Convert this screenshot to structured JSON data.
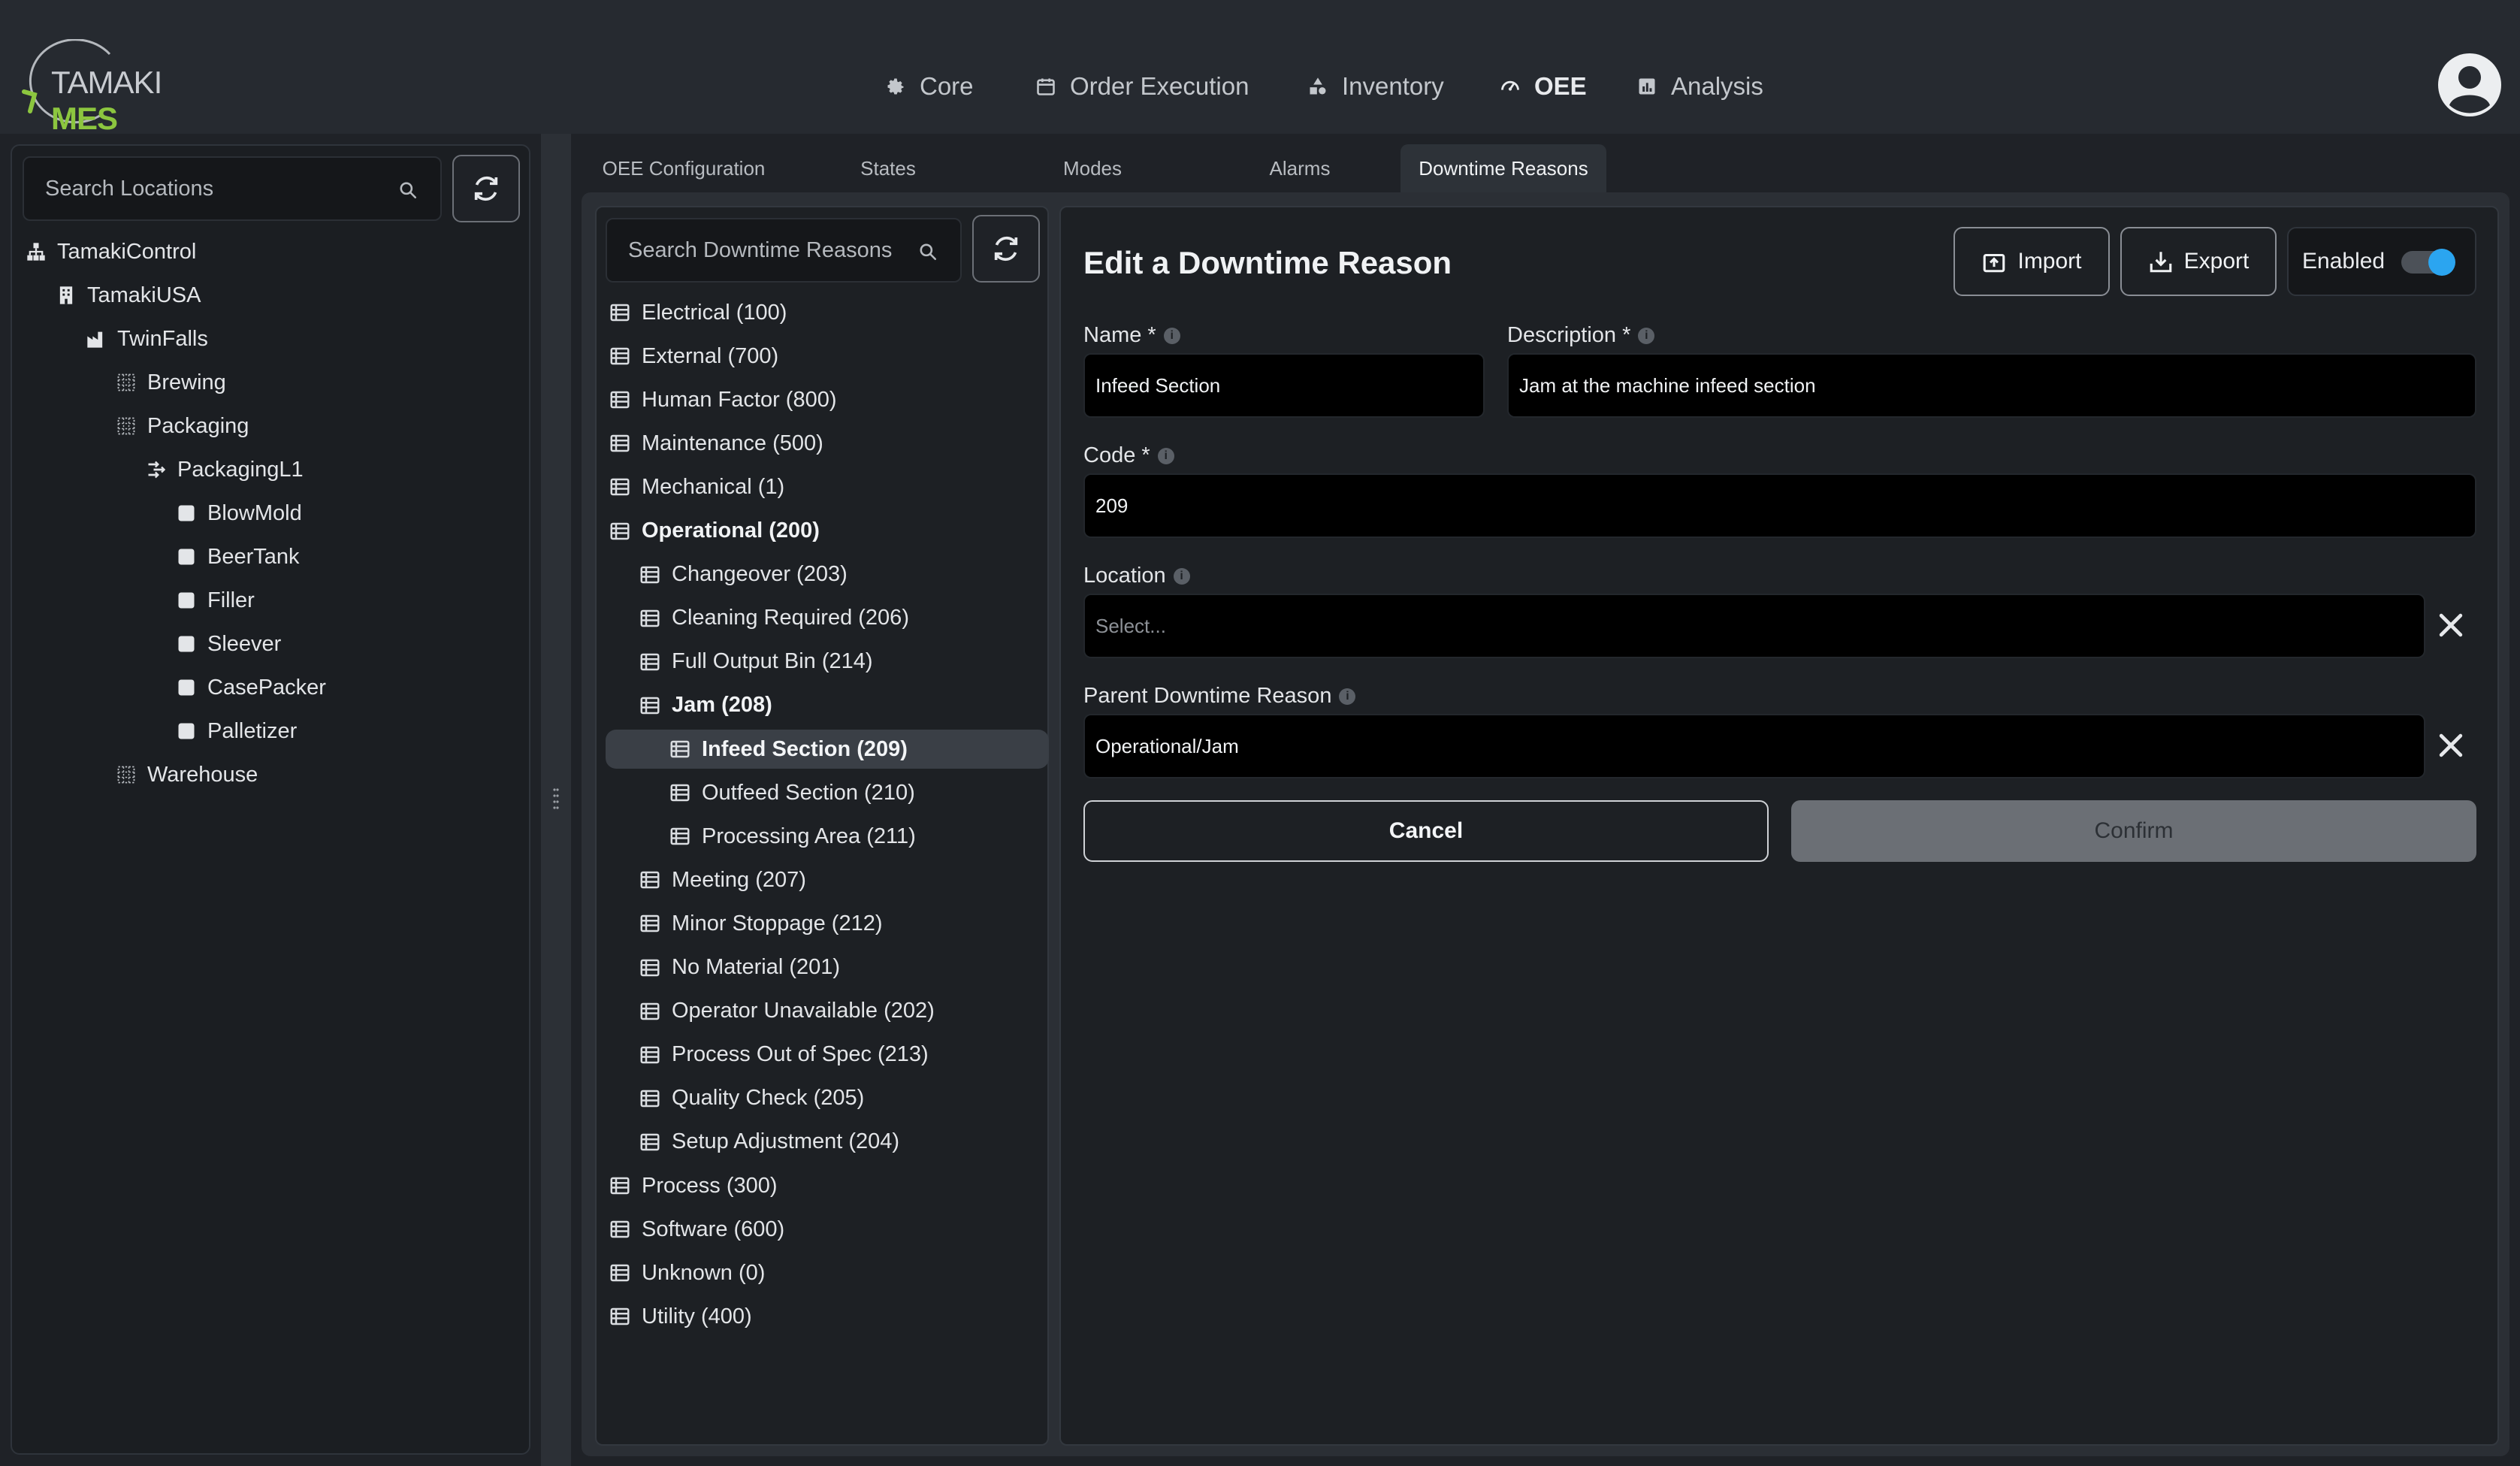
{
  "brand": {
    "part1": "TAMAKI",
    "part2": "MES"
  },
  "nav": [
    {
      "label": "Core",
      "icon": "gear-icon"
    },
    {
      "label": "Order Execution",
      "icon": "calendar-icon"
    },
    {
      "label": "Inventory",
      "icon": "shapes-icon"
    },
    {
      "label": "OEE",
      "icon": "gauge-icon",
      "active": true
    },
    {
      "label": "Analysis",
      "icon": "chart-icon"
    }
  ],
  "locations": {
    "search_placeholder": "Search Locations",
    "tree": [
      {
        "label": "TamakiControl",
        "icon": "org-icon"
      },
      {
        "label": "TamakiUSA",
        "icon": "building-icon"
      },
      {
        "label": "TwinFalls",
        "icon": "factory-icon"
      },
      {
        "label": "Brewing",
        "icon": "area-icon"
      },
      {
        "label": "Packaging",
        "icon": "area-icon"
      },
      {
        "label": "PackagingL1",
        "icon": "line-icon"
      },
      {
        "label": "BlowMold",
        "icon": "cell-icon"
      },
      {
        "label": "BeerTank",
        "icon": "cell-icon"
      },
      {
        "label": "Filler",
        "icon": "cell-icon"
      },
      {
        "label": "Sleever",
        "icon": "cell-icon"
      },
      {
        "label": "CasePacker",
        "icon": "cell-icon"
      },
      {
        "label": "Palletizer",
        "icon": "cell-icon"
      },
      {
        "label": "Warehouse",
        "icon": "area-icon"
      }
    ]
  },
  "tabs": [
    {
      "label": "OEE Configuration"
    },
    {
      "label": "States"
    },
    {
      "label": "Modes"
    },
    {
      "label": "Alarms"
    },
    {
      "label": "Downtime Reasons",
      "active": true
    }
  ],
  "reasons": {
    "search_placeholder": "Search Downtime Reasons",
    "items": [
      {
        "label": "Electrical (100)"
      },
      {
        "label": "External (700)"
      },
      {
        "label": "Human Factor (800)"
      },
      {
        "label": "Maintenance (500)"
      },
      {
        "label": "Mechanical (1)"
      },
      {
        "label": "Operational (200)"
      },
      {
        "label": "Changeover (203)"
      },
      {
        "label": "Cleaning Required (206)"
      },
      {
        "label": "Full Output Bin (214)"
      },
      {
        "label": "Jam (208)"
      },
      {
        "label": "Infeed Section (209)"
      },
      {
        "label": "Outfeed Section (210)"
      },
      {
        "label": "Processing Area (211)"
      },
      {
        "label": "Meeting (207)"
      },
      {
        "label": "Minor Stoppage (212)"
      },
      {
        "label": "No Material (201)"
      },
      {
        "label": "Operator Unavailable (202)"
      },
      {
        "label": "Process Out of Spec (213)"
      },
      {
        "label": "Quality Check (205)"
      },
      {
        "label": "Setup Adjustment (204)"
      },
      {
        "label": "Process (300)"
      },
      {
        "label": "Software (600)"
      },
      {
        "label": "Unknown (0)"
      },
      {
        "label": "Utility (400)"
      }
    ]
  },
  "form": {
    "title": "Edit a Downtime Reason",
    "import_label": "Import",
    "export_label": "Export",
    "enabled_label": "Enabled",
    "enabled": true,
    "name_label": "Name *",
    "name_value": "Infeed Section",
    "description_label": "Description *",
    "description_value": "Jam at the machine infeed section",
    "code_label": "Code *",
    "code_value": "209",
    "location_label": "Location",
    "location_placeholder": "Select...",
    "parent_label": "Parent Downtime Reason",
    "parent_value": "Operational/Jam",
    "cancel_label": "Cancel",
    "confirm_label": "Confirm",
    "info_glyph": "i"
  },
  "colors": {
    "accent": "#2ba5f0",
    "brand_green": "#8cc63f",
    "background": "#1f2227"
  }
}
